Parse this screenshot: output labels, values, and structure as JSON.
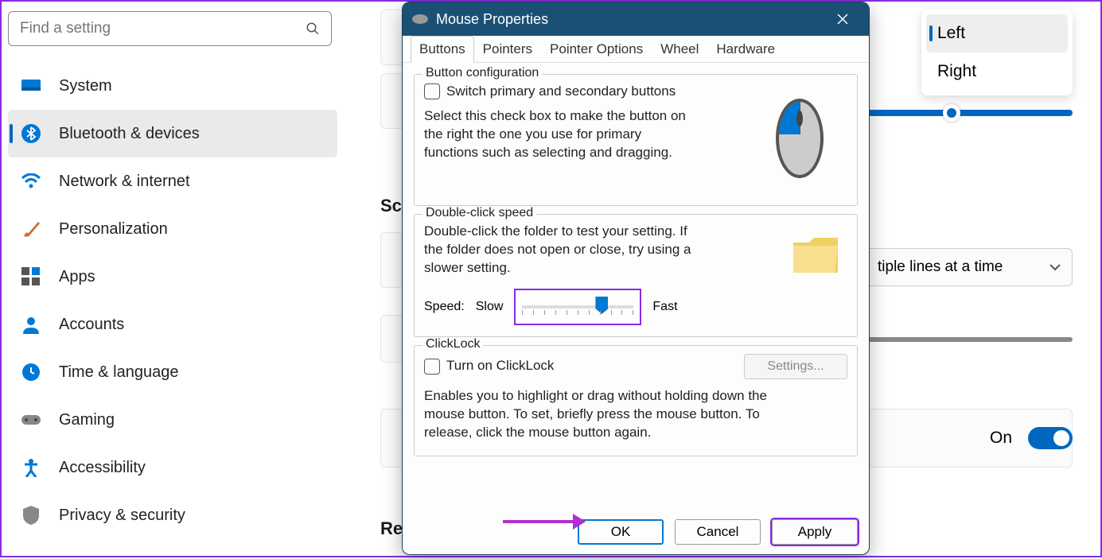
{
  "sidebar": {
    "search_placeholder": "Find a setting",
    "items": [
      {
        "label": "System"
      },
      {
        "label": "Bluetooth & devices",
        "selected": true
      },
      {
        "label": "Network & internet"
      },
      {
        "label": "Personalization"
      },
      {
        "label": "Apps"
      },
      {
        "label": "Accounts"
      },
      {
        "label": "Time & language"
      },
      {
        "label": "Gaming"
      },
      {
        "label": "Accessibility"
      },
      {
        "label": "Privacy & security"
      }
    ]
  },
  "background": {
    "primary_button_options": {
      "left": "Left",
      "right": "Right",
      "selected": "Left"
    },
    "section1": "Scr",
    "dropdown_visible": "tiple lines at a time",
    "section2": "Re",
    "toggle_label": "On",
    "toggle_state": true
  },
  "dialog": {
    "title": "Mouse Properties",
    "tabs": [
      "Buttons",
      "Pointers",
      "Pointer Options",
      "Wheel",
      "Hardware"
    ],
    "active_tab": "Buttons",
    "button_config": {
      "legend": "Button configuration",
      "checkbox_label": "Switch primary and secondary buttons",
      "desc": "Select this check box to make the button on the right the one you use for primary functions such as selecting and dragging."
    },
    "dblclick": {
      "legend": "Double-click speed",
      "desc": "Double-click the folder to test your setting. If the folder does not open or close, try using a slower setting.",
      "speed_label": "Speed:",
      "slow": "Slow",
      "fast": "Fast"
    },
    "clicklock": {
      "legend": "ClickLock",
      "checkbox_label": "Turn on ClickLock",
      "settings_btn": "Settings...",
      "desc": "Enables you to highlight or drag without holding down the mouse button. To set, briefly press the mouse button. To release, click the mouse button again."
    },
    "buttons": {
      "ok": "OK",
      "cancel": "Cancel",
      "apply": "Apply"
    }
  }
}
